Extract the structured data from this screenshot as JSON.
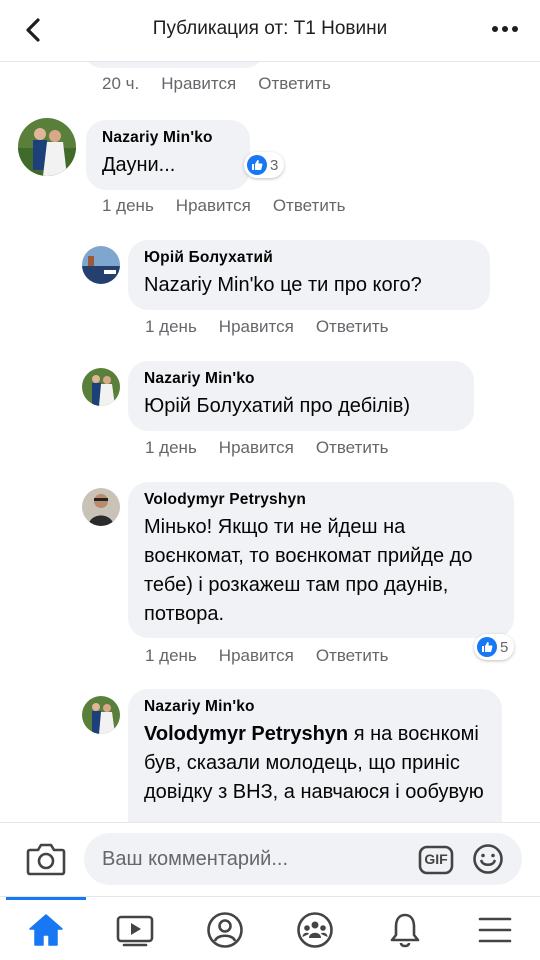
{
  "header": {
    "title": "Публикация от: Т1 Новини"
  },
  "actions": {
    "like": "Нравится",
    "reply": "Ответить"
  },
  "prev_comment": {
    "time": "20 ч."
  },
  "comments": [
    {
      "author": "Nazariy Min'ko",
      "text": "Дауни...",
      "time": "1 день",
      "reactions": "3"
    },
    {
      "author": "Юрій Болухатий",
      "text": "Nazariy Min'ko це ти про кого?",
      "time": "1 день"
    },
    {
      "author": "Nazariy Min'ko",
      "text": "Юрій Болухатий про дебілів)",
      "time": "1 день"
    },
    {
      "author": "Volodymyr Petryshyn",
      "text": "Мінько! Якщо ти не йдеш на воєнкомат, то воєнкомат прийде до тебе) і розкажеш там про даунів, потвора.",
      "time": "1 день",
      "reactions": "5"
    },
    {
      "author": "Nazariy Min'ko",
      "mention": "Volodymyr Petryshyn",
      "text": " я на воєнкомі був, сказали молодець, що приніс довідку з ВНЗ, а навчаюся і ообувую"
    }
  ],
  "composer": {
    "placeholder": "Ваш комментарий...",
    "gif": "GIF"
  },
  "tabs": [
    "home-icon",
    "video-icon",
    "profile-icon",
    "groups-icon",
    "notifications-icon",
    "menu-icon"
  ],
  "colors": {
    "accent": "#1877f2",
    "bubble": "#f0f2f5",
    "meta": "#65676b"
  }
}
